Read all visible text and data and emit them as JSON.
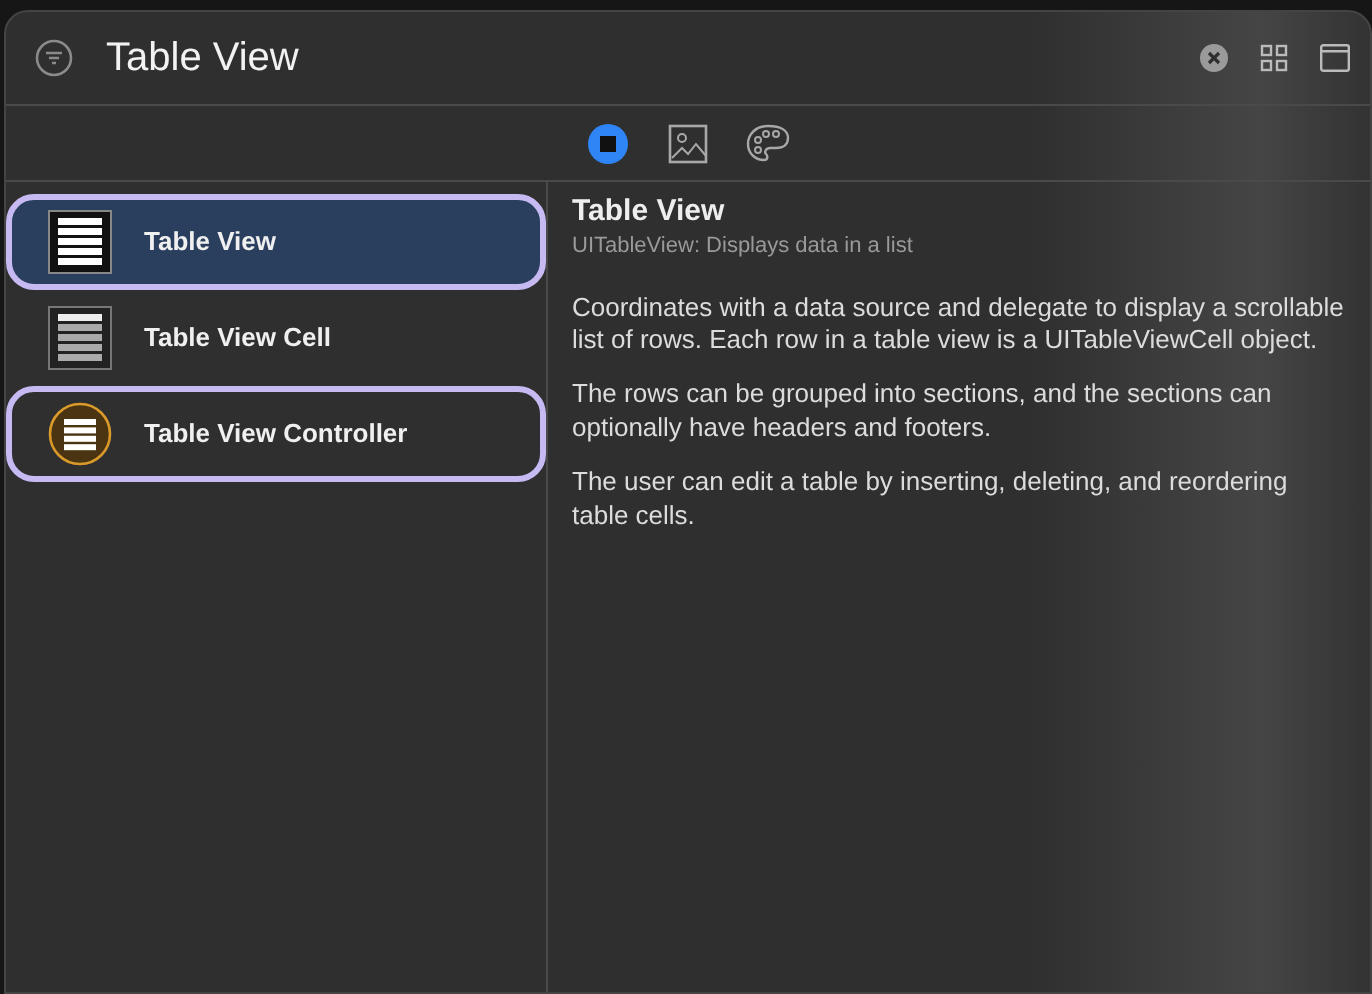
{
  "window": {
    "title": "Table View"
  },
  "tabs": [
    {
      "kind": "object",
      "selected": true
    },
    {
      "kind": "media",
      "selected": false
    },
    {
      "kind": "color",
      "selected": false
    }
  ],
  "library": {
    "items": [
      {
        "kind": "table",
        "label": "Table View",
        "selected": true,
        "highlighted": true
      },
      {
        "kind": "cell",
        "label": "Table View Cell",
        "selected": false,
        "highlighted": false
      },
      {
        "kind": "controller",
        "label": "Table View Controller",
        "selected": false,
        "highlighted": true
      }
    ]
  },
  "detail": {
    "title": "Table View",
    "subtitle": "UITableView: Displays data in a list",
    "paragraphs": [
      "Coordinates with a data source and delegate to display a scrollable list of rows. Each row in a table view is a UITableViewCell object.",
      "The rows can be grouped into sections, and the sections can optionally have headers and footers.",
      "The user can edit a table by inserting, deleting, and reordering table cells."
    ]
  }
}
